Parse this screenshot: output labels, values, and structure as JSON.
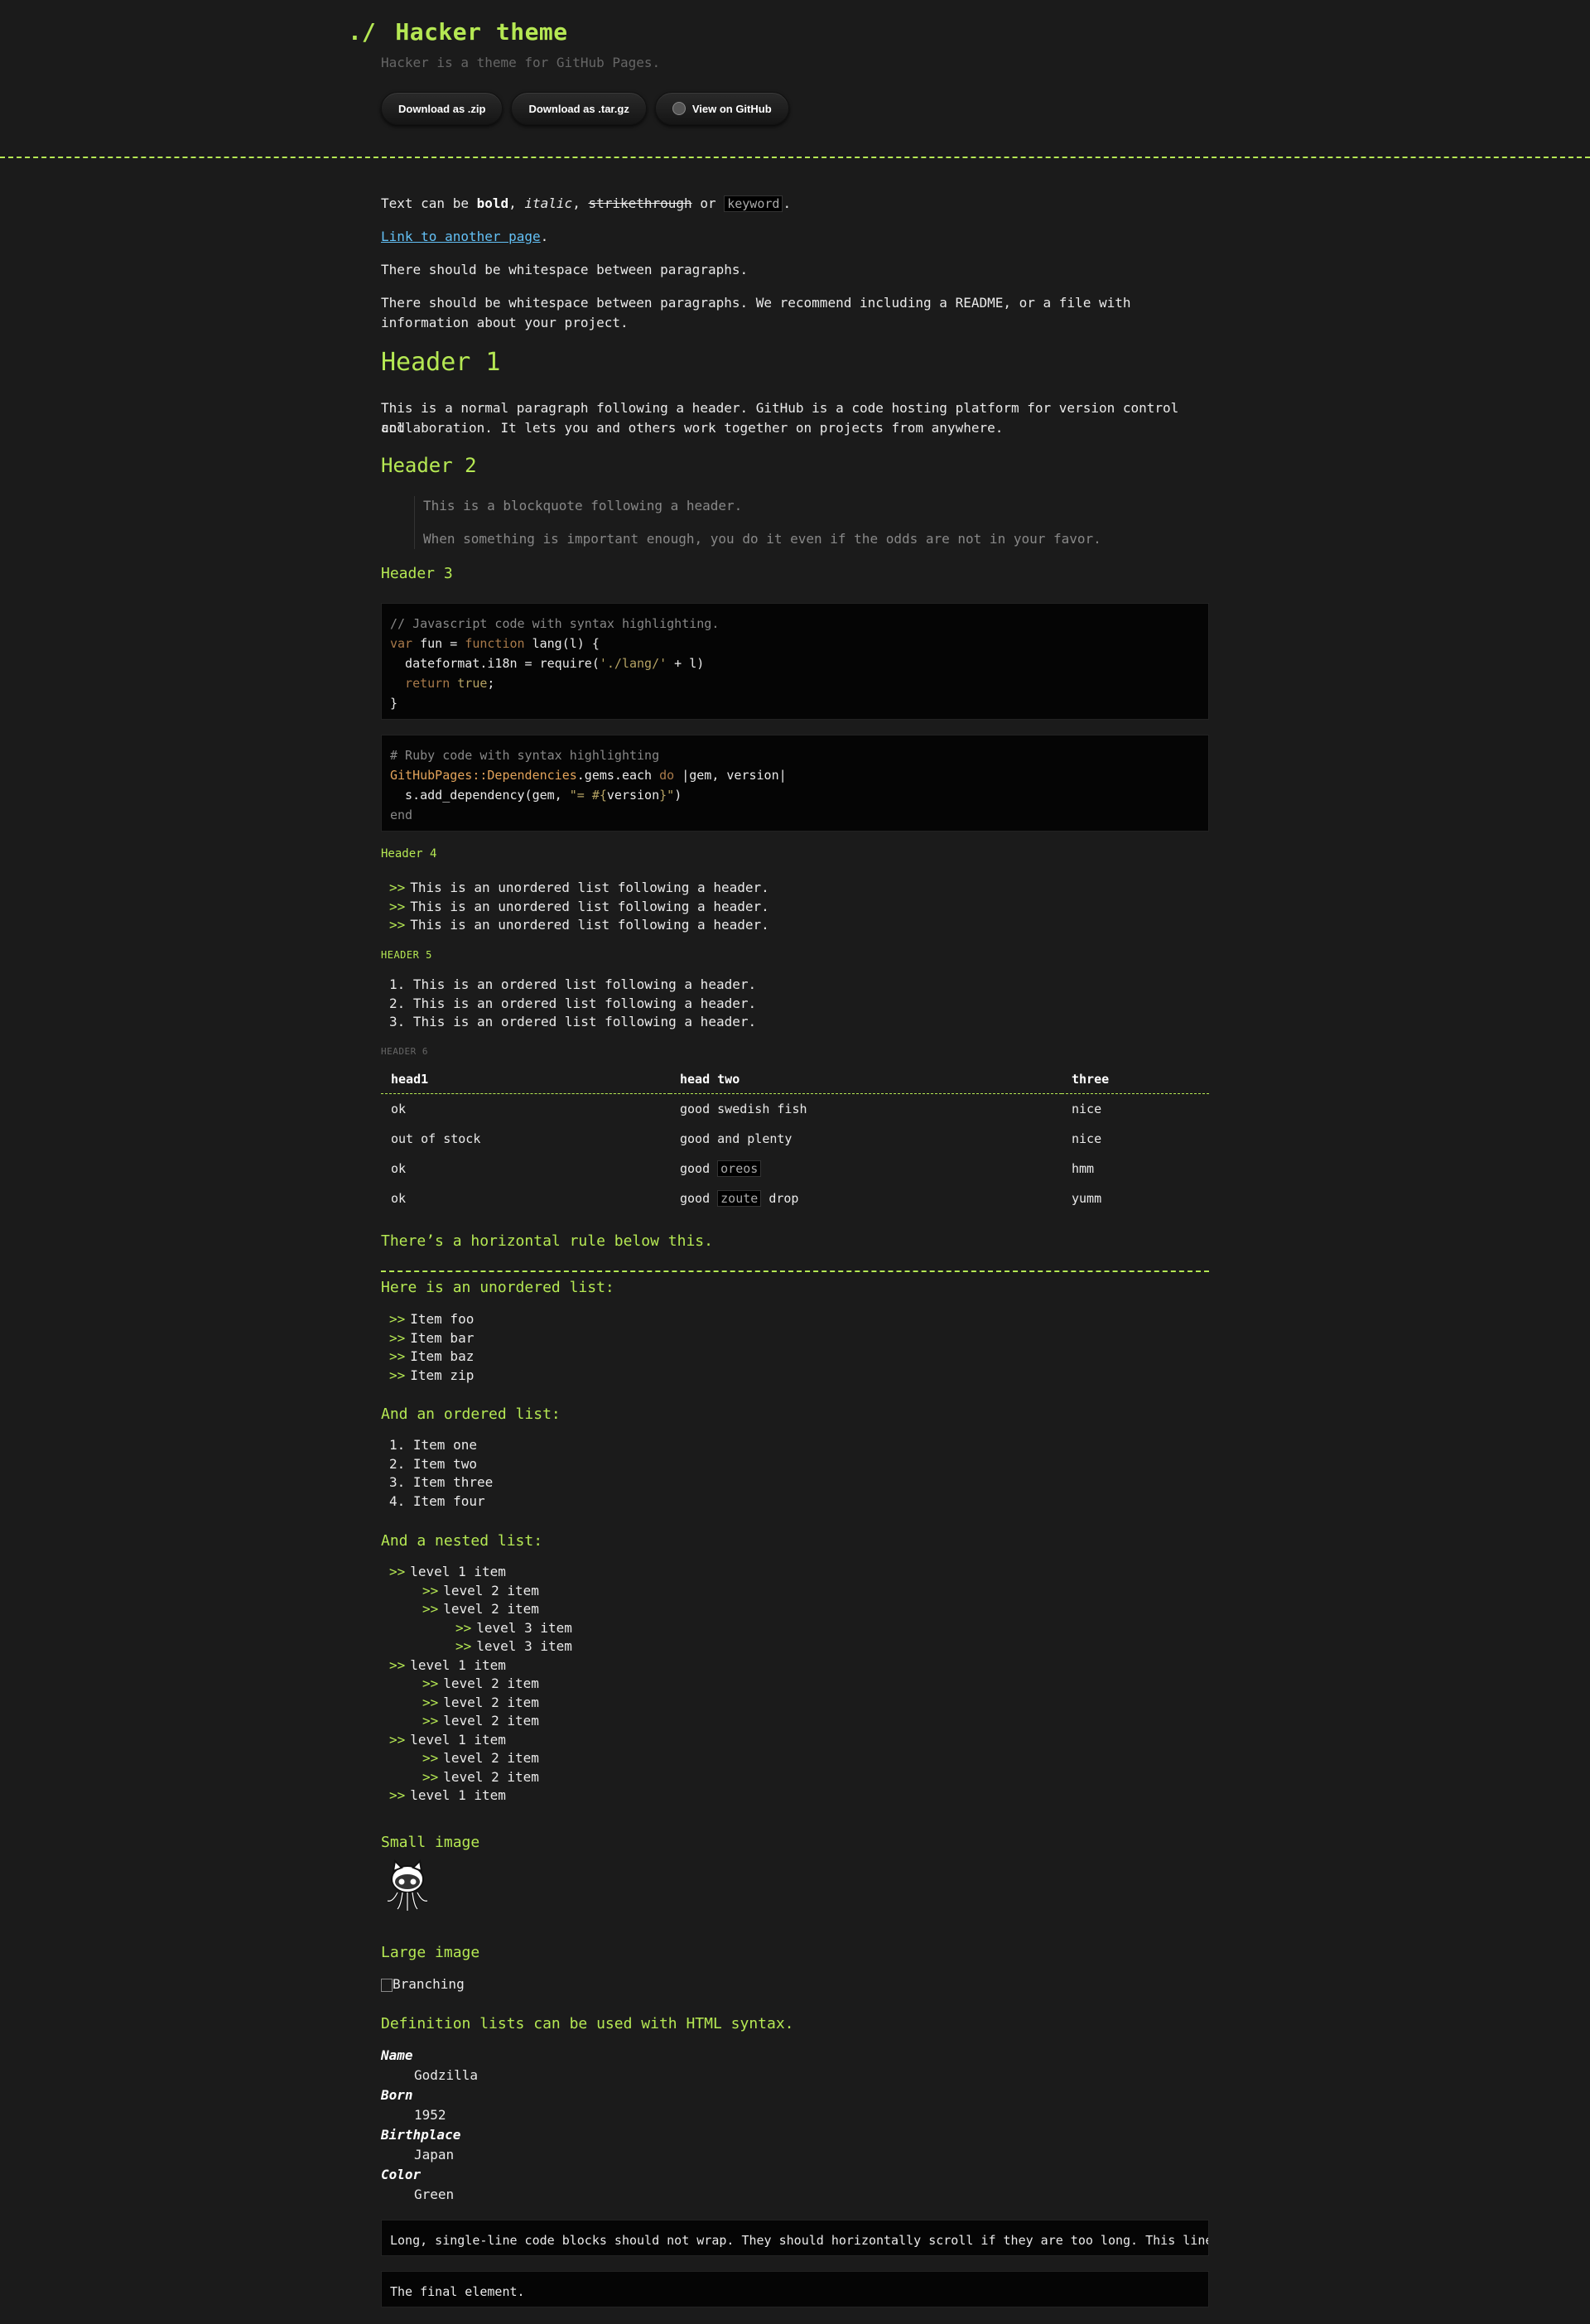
{
  "header": {
    "prompt": "./",
    "title": "Hacker theme",
    "subtitle": "Hacker is a theme for GitHub Pages.",
    "buttons": {
      "zip": "Download as .zip",
      "targz": "Download as .tar.gz",
      "github": "View on GitHub"
    }
  },
  "intro": {
    "text_prefix": "Text can be ",
    "bold": "bold",
    "sep1": ", ",
    "italic": "italic",
    "sep2": ", ",
    "strike": "strikethrough",
    "or": " or ",
    "keyword": "keyword",
    "end": ".",
    "link": "Link to another page",
    "link_end": ".",
    "p1": "There should be whitespace between paragraphs.",
    "p2a": "There should be whitespace between paragraphs. We recommend including a README, or a file with",
    "p2b": "information about your project."
  },
  "h1": "Header 1",
  "h1_para_a": "This is a normal paragraph following a header. GitHub is a code hosting platform for version control and",
  "h1_para_b": "collaboration. It lets you and others work together on projects from anywhere.",
  "h2": "Header 2",
  "blockquote": {
    "line1": "This is a blockquote following a header.",
    "line2": "When something is important enough, you do it even if the odds are not in your favor."
  },
  "h3": "Header 3",
  "js_code": {
    "l1": "// Javascript code with syntax highlighting.",
    "l2a": "var",
    "l2b": " fun = ",
    "l2c": "function",
    "l2d": " lang(l) {",
    "l3a": "  dateformat.i18n = require(",
    "l3b": "'./lang/'",
    "l3c": " + l)",
    "l4a": "  return",
    "l4b": " true",
    "l4c": ";",
    "l5": "}"
  },
  "ruby_code": {
    "l1": "# Ruby code with syntax highlighting",
    "l2a": "GitHubPages::Dependencies",
    "l2b": ".gems.each ",
    "l2c": "do",
    "l2d": " |gem, version|",
    "l3a": "  s.add_dependency(gem, ",
    "l3b": "\"= #{",
    "l3c": "version",
    "l3d": "}\"",
    "l3e": ")",
    "l4": "end"
  },
  "h4": "Header 4",
  "ul1": [
    "This is an unordered list following a header.",
    "This is an unordered list following a header.",
    "This is an unordered list following a header."
  ],
  "h5": "Header 5",
  "ol1": [
    "1. This is an ordered list following a header.",
    "2. This is an ordered list following a header.",
    "3. This is an ordered list following a header."
  ],
  "h6": "Header 6",
  "table": {
    "headers": [
      "head1",
      "head two",
      "three"
    ],
    "rows": [
      {
        "c1": "ok",
        "c2a": "good swedish fish",
        "c2code": "",
        "c2b": "",
        "c3": "nice"
      },
      {
        "c1": "out of stock",
        "c2a": "good and plenty",
        "c2code": "",
        "c2b": "",
        "c3": "nice"
      },
      {
        "c1": "ok",
        "c2a": "good ",
        "c2code": "oreos",
        "c2b": "",
        "c3": "hmm"
      },
      {
        "c1": "ok",
        "c2a": "good ",
        "c2code": "zoute",
        "c2b": " drop",
        "c3": "yumm"
      }
    ]
  },
  "hr_label": "There’s a horizontal rule below this.",
  "ul2_label": "Here is an unordered list:",
  "ul2": [
    "Item foo",
    "Item bar",
    "Item baz",
    "Item zip"
  ],
  "ol2_label": "And an ordered list:",
  "ol2": [
    "1. Item one",
    "2. Item two",
    "3. Item three",
    "4. Item four"
  ],
  "nested_label": "And a nested list:",
  "nested": [
    "level 1 item",
    "level 2 item",
    "level 2 item",
    "level 3 item",
    "level 3 item",
    "level 1 item",
    "level 2 item",
    "level 2 item",
    "level 2 item",
    "level 1 item",
    "level 2 item",
    "level 2 item",
    "level 1 item"
  ],
  "list_marker": ">>",
  "small_image_label": "Small image",
  "large_image_label": "Large image",
  "large_image_alt": "Branching",
  "dl_label": "Definition lists can be used with HTML syntax.",
  "dl": {
    "name_t": "Name",
    "name_d": "Godzilla",
    "born_t": "Born",
    "born_d": "1952",
    "place_t": "Birthplace",
    "place_d": "Japan",
    "color_t": "Color",
    "color_d": "Green"
  },
  "long_code": "Long, single-line code blocks should not wrap. They should horizontally scroll if they are too long. This line should be long enough to demonstrate this.",
  "final_code": "The final element.",
  "colors": {
    "accent": "#b5e853",
    "background": "#1b1b1b",
    "link": "#63c0f5"
  }
}
